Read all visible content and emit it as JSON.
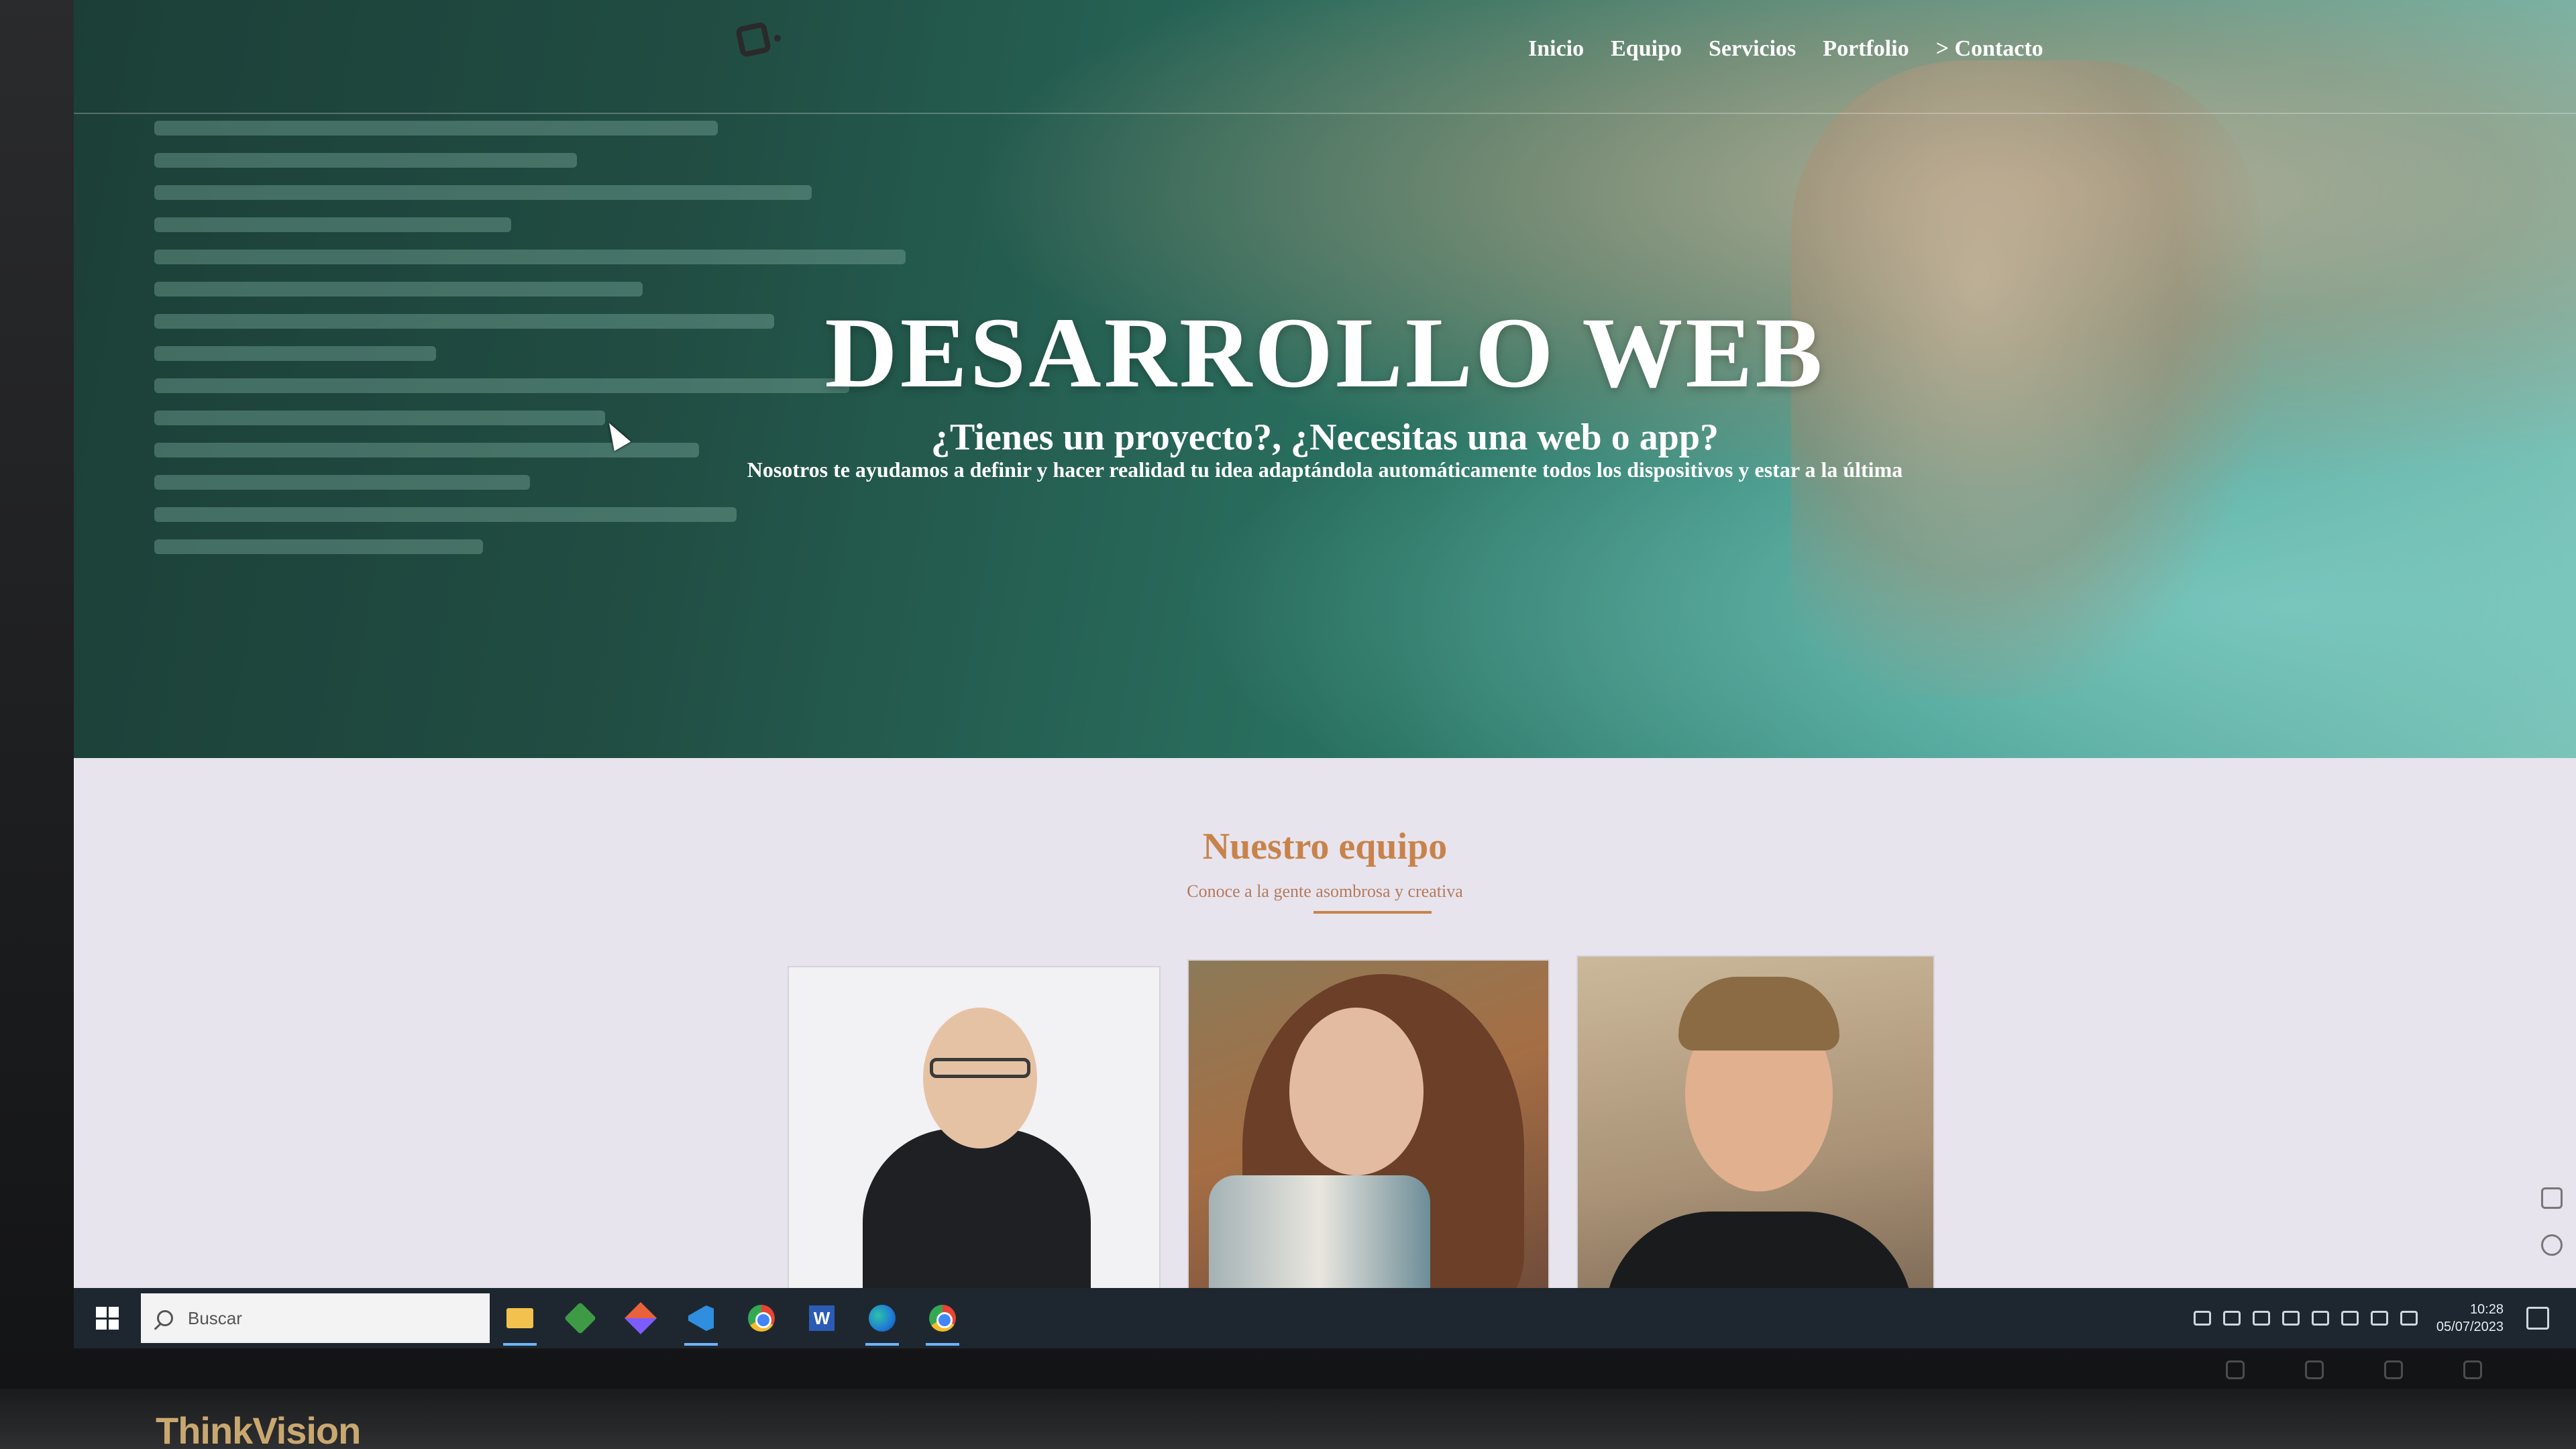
{
  "nav": {
    "items": [
      {
        "label": "Inicio"
      },
      {
        "label": "Equipo"
      },
      {
        "label": "Servicios"
      },
      {
        "label": "Portfolio"
      },
      {
        "label": "> Contacto"
      }
    ]
  },
  "hero": {
    "title": "DESARROLLO WEB",
    "subtitle": "¿Tienes un proyecto?, ¿Necesitas una web o app?",
    "text": "Nosotros te ayudamos a definir y hacer realidad tu idea adaptándola automáticamente todos los dispositivos y estar a la última"
  },
  "team": {
    "title": "Nuestro equipo",
    "subtitle": "Conoce a la gente asombrosa y creativa"
  },
  "taskbar": {
    "search_placeholder": "Buscar",
    "apps": [
      "file-explorer",
      "green-cube-app",
      "git-app",
      "vscode",
      "chrome",
      "word",
      "edge",
      "chrome"
    ],
    "clock_time": "10:28",
    "clock_date": "05/07/2023"
  },
  "monitor": {
    "brand": "ThinkVision"
  }
}
